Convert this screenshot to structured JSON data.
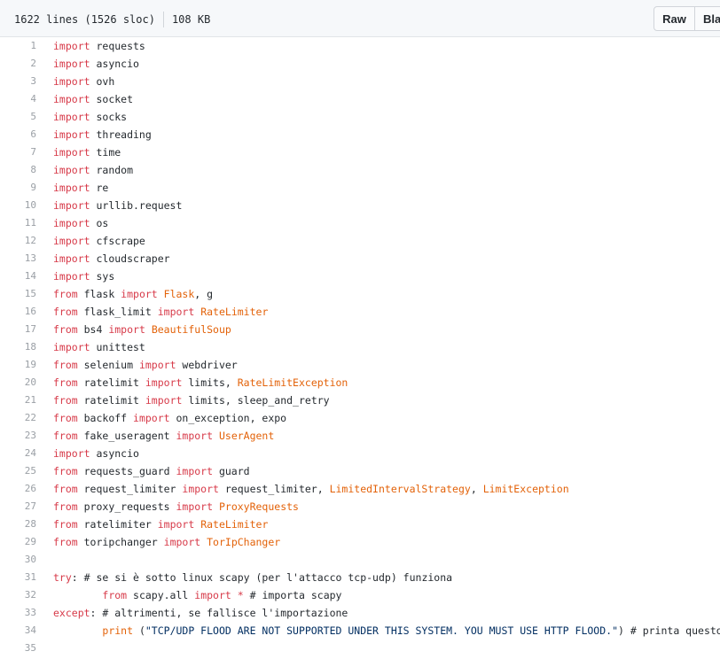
{
  "file_info": {
    "lines": "1622 lines (1526 sloc)",
    "size": "108 KB"
  },
  "toolbar": {
    "raw_label": "Raw",
    "blame_label": "Blame"
  },
  "code": {
    "lines": [
      {
        "n": "1",
        "tokens": [
          {
            "t": "import",
            "c": "kw"
          },
          {
            "t": " requests"
          }
        ]
      },
      {
        "n": "2",
        "tokens": [
          {
            "t": "import",
            "c": "kw"
          },
          {
            "t": " asyncio"
          }
        ]
      },
      {
        "n": "3",
        "tokens": [
          {
            "t": "import",
            "c": "kw"
          },
          {
            "t": " ovh"
          }
        ]
      },
      {
        "n": "4",
        "tokens": [
          {
            "t": "import",
            "c": "kw"
          },
          {
            "t": " socket"
          }
        ]
      },
      {
        "n": "5",
        "tokens": [
          {
            "t": "import",
            "c": "kw"
          },
          {
            "t": " socks"
          }
        ]
      },
      {
        "n": "6",
        "tokens": [
          {
            "t": "import",
            "c": "kw"
          },
          {
            "t": " threading"
          }
        ]
      },
      {
        "n": "7",
        "tokens": [
          {
            "t": "import",
            "c": "kw"
          },
          {
            "t": " time"
          }
        ]
      },
      {
        "n": "8",
        "tokens": [
          {
            "t": "import",
            "c": "kw"
          },
          {
            "t": " random"
          }
        ]
      },
      {
        "n": "9",
        "tokens": [
          {
            "t": "import",
            "c": "kw"
          },
          {
            "t": " re"
          }
        ]
      },
      {
        "n": "10",
        "tokens": [
          {
            "t": "import",
            "c": "kw"
          },
          {
            "t": " urllib.request"
          }
        ]
      },
      {
        "n": "11",
        "tokens": [
          {
            "t": "import",
            "c": "kw"
          },
          {
            "t": " os"
          }
        ]
      },
      {
        "n": "12",
        "tokens": [
          {
            "t": "import",
            "c": "kw"
          },
          {
            "t": " cfscrape"
          }
        ]
      },
      {
        "n": "13",
        "tokens": [
          {
            "t": "import",
            "c": "kw"
          },
          {
            "t": " cloudscraper"
          }
        ]
      },
      {
        "n": "14",
        "tokens": [
          {
            "t": "import",
            "c": "kw"
          },
          {
            "t": " sys"
          }
        ]
      },
      {
        "n": "15",
        "tokens": [
          {
            "t": "from",
            "c": "kw"
          },
          {
            "t": " flask "
          },
          {
            "t": "import",
            "c": "kw"
          },
          {
            "t": " "
          },
          {
            "t": "Flask",
            "c": "cls"
          },
          {
            "t": ", g"
          }
        ]
      },
      {
        "n": "16",
        "tokens": [
          {
            "t": "from",
            "c": "kw"
          },
          {
            "t": " flask_limit "
          },
          {
            "t": "import",
            "c": "kw"
          },
          {
            "t": " "
          },
          {
            "t": "RateLimiter",
            "c": "cls"
          }
        ]
      },
      {
        "n": "17",
        "tokens": [
          {
            "t": "from",
            "c": "kw"
          },
          {
            "t": " bs4 "
          },
          {
            "t": "import",
            "c": "kw"
          },
          {
            "t": " "
          },
          {
            "t": "BeautifulSoup",
            "c": "cls"
          }
        ]
      },
      {
        "n": "18",
        "tokens": [
          {
            "t": "import",
            "c": "kw"
          },
          {
            "t": " unittest"
          }
        ]
      },
      {
        "n": "19",
        "tokens": [
          {
            "t": "from",
            "c": "kw"
          },
          {
            "t": " selenium "
          },
          {
            "t": "import",
            "c": "kw"
          },
          {
            "t": " webdriver"
          }
        ]
      },
      {
        "n": "20",
        "tokens": [
          {
            "t": "from",
            "c": "kw"
          },
          {
            "t": " ratelimit "
          },
          {
            "t": "import",
            "c": "kw"
          },
          {
            "t": " limits, "
          },
          {
            "t": "RateLimitException",
            "c": "cls"
          }
        ]
      },
      {
        "n": "21",
        "tokens": [
          {
            "t": "from",
            "c": "kw"
          },
          {
            "t": " ratelimit "
          },
          {
            "t": "import",
            "c": "kw"
          },
          {
            "t": " limits, sleep_and_retry"
          }
        ]
      },
      {
        "n": "22",
        "tokens": [
          {
            "t": "from",
            "c": "kw"
          },
          {
            "t": " backoff "
          },
          {
            "t": "import",
            "c": "kw"
          },
          {
            "t": " on_exception, expo"
          }
        ]
      },
      {
        "n": "23",
        "tokens": [
          {
            "t": "from",
            "c": "kw"
          },
          {
            "t": " fake_useragent "
          },
          {
            "t": "import",
            "c": "kw"
          },
          {
            "t": " "
          },
          {
            "t": "UserAgent",
            "c": "cls"
          }
        ]
      },
      {
        "n": "24",
        "tokens": [
          {
            "t": "import",
            "c": "kw"
          },
          {
            "t": " asyncio"
          }
        ]
      },
      {
        "n": "25",
        "tokens": [
          {
            "t": "from",
            "c": "kw"
          },
          {
            "t": " requests_guard "
          },
          {
            "t": "import",
            "c": "kw"
          },
          {
            "t": " guard"
          }
        ]
      },
      {
        "n": "26",
        "tokens": [
          {
            "t": "from",
            "c": "kw"
          },
          {
            "t": " request_limiter "
          },
          {
            "t": "import",
            "c": "kw"
          },
          {
            "t": " request_limiter, "
          },
          {
            "t": "LimitedIntervalStrategy",
            "c": "cls"
          },
          {
            "t": ", "
          },
          {
            "t": "LimitException",
            "c": "cls"
          }
        ]
      },
      {
        "n": "27",
        "tokens": [
          {
            "t": "from",
            "c": "kw"
          },
          {
            "t": " proxy_requests "
          },
          {
            "t": "import",
            "c": "kw"
          },
          {
            "t": " "
          },
          {
            "t": "ProxyRequests",
            "c": "cls"
          }
        ]
      },
      {
        "n": "28",
        "tokens": [
          {
            "t": "from",
            "c": "kw"
          },
          {
            "t": " ratelimiter "
          },
          {
            "t": "import",
            "c": "kw"
          },
          {
            "t": " "
          },
          {
            "t": "RateLimiter",
            "c": "cls"
          }
        ]
      },
      {
        "n": "29",
        "tokens": [
          {
            "t": "from",
            "c": "kw"
          },
          {
            "t": " toripchanger "
          },
          {
            "t": "import",
            "c": "kw"
          },
          {
            "t": " "
          },
          {
            "t": "TorIpChanger",
            "c": "cls"
          }
        ]
      },
      {
        "n": "30",
        "tokens": []
      },
      {
        "n": "31",
        "tokens": [
          {
            "t": "try",
            "c": "kw"
          },
          {
            "t": ": "
          },
          {
            "t": "# se si è sotto linux scapy (per l'attacco tcp-udp) funziona",
            "c": "cm"
          }
        ]
      },
      {
        "n": "32",
        "tokens": [
          {
            "t": "        "
          },
          {
            "t": "from",
            "c": "kw"
          },
          {
            "t": " scapy.all "
          },
          {
            "t": "import",
            "c": "kw"
          },
          {
            "t": " "
          },
          {
            "t": "*",
            "c": "kw"
          },
          {
            "t": " "
          },
          {
            "t": "# importa scapy",
            "c": "cm"
          }
        ]
      },
      {
        "n": "33",
        "tokens": [
          {
            "t": "except",
            "c": "kw"
          },
          {
            "t": ": "
          },
          {
            "t": "# altrimenti, se fallisce l'importazione",
            "c": "cm"
          }
        ]
      },
      {
        "n": "34",
        "tokens": [
          {
            "t": "        "
          },
          {
            "t": "print",
            "c": "cls"
          },
          {
            "t": " ("
          },
          {
            "t": "\"TCP/UDP FLOOD ARE NOT SUPPORTED UNDER THIS SYSTEM. YOU MUST USE HTTP FLOOD.\"",
            "c": "str"
          },
          {
            "t": ") "
          },
          {
            "t": "# printa questo",
            "c": "cm"
          }
        ]
      },
      {
        "n": "35",
        "tokens": []
      }
    ]
  }
}
